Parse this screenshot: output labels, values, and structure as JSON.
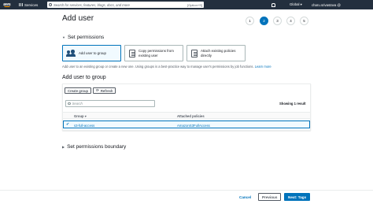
{
  "topnav": {
    "logo_text": "aws",
    "services_label": "Services",
    "search_placeholder": "Search for services, features, blogs, docs, and more",
    "search_shortcut": "[Option+S]",
    "region": "Global ▾",
    "account": "charu.srivastava @"
  },
  "page": {
    "title": "Add user",
    "steps": [
      "1",
      "2",
      "3",
      "4",
      "5"
    ],
    "active_step": "2"
  },
  "permissions": {
    "heading": "Set permissions",
    "options": [
      {
        "label": "Add user to group",
        "icon": "users-icon",
        "selected": true
      },
      {
        "label": "Copy permissions from existing user",
        "icon": "document-icon",
        "selected": false
      },
      {
        "label": "Attach existing policies directly",
        "icon": "document-icon",
        "selected": false
      }
    ],
    "description": "Add user to an existing group or create a new one. Using groups is a best-practice way to manage user's permissions by job functions.",
    "learn_more": "Learn more"
  },
  "group_section": {
    "title": "Add user to group",
    "create_group": "Create group",
    "refresh": "Refresh",
    "search_placeholder": "Search",
    "showing": "Showing 1 result",
    "columns": {
      "group": "Group ▾",
      "policies": "Attached policies"
    },
    "rows": [
      {
        "group": "s3-full-access",
        "policies": "AmazonS3FullAccess",
        "checked": true
      }
    ]
  },
  "boundary": {
    "heading": "Set permissions boundary"
  },
  "footer": {
    "cancel": "Cancel",
    "previous": "Previous",
    "next": "Next: Tags"
  },
  "colors": {
    "nav_bg": "#232f3e",
    "accent": "#0073bb",
    "selected_bg": "#f1faff"
  }
}
